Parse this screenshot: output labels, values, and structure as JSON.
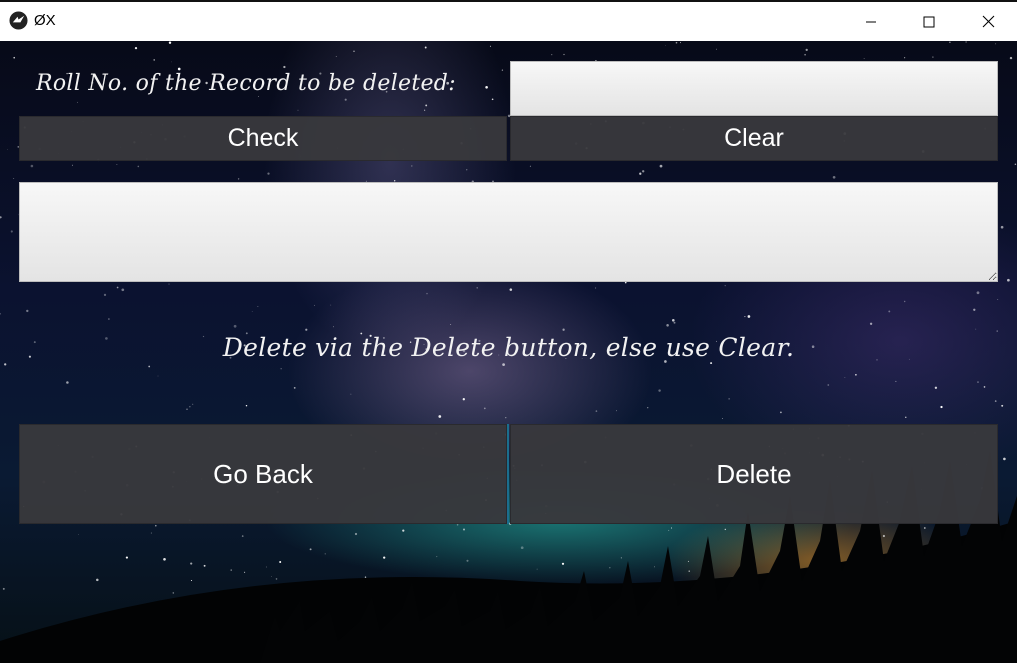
{
  "window": {
    "title": "ØX",
    "icon": "kivy-app-icon",
    "controls": [
      "minimize-icon",
      "maximize-icon",
      "close-icon"
    ]
  },
  "form": {
    "roll_label": "Roll No. of the Record to be deleted:",
    "roll_input_value": "",
    "check_label": "Check",
    "clear_label": "Clear",
    "output_value": "",
    "hint": "Delete via the Delete button, else use Clear.",
    "go_back_label": "Go Back",
    "delete_label": "Delete"
  },
  "colors": {
    "button_bg": "#38383c",
    "button_text": "#ffffff",
    "input_bg": "#eeeeee",
    "accent_divider": "#1b6e8e"
  }
}
